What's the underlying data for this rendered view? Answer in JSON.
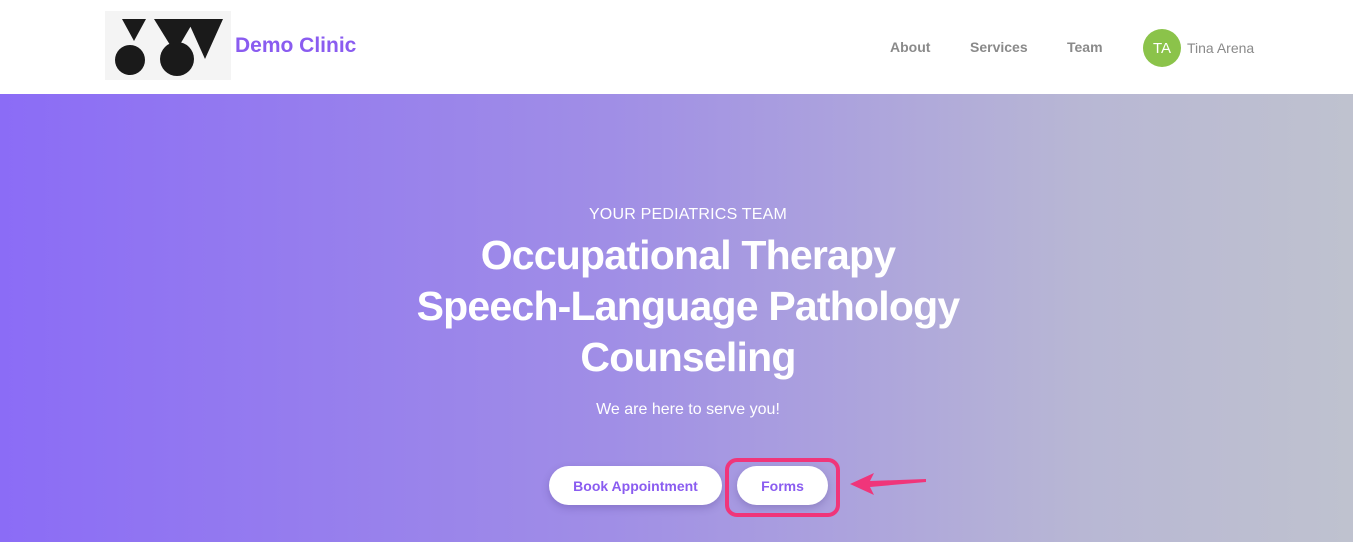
{
  "header": {
    "brand_name": "Demo Clinic",
    "logo_icon": "clinic-logo-icon",
    "nav": [
      {
        "label": "About"
      },
      {
        "label": "Services"
      },
      {
        "label": "Team"
      }
    ],
    "user": {
      "initials": "TA",
      "name": "Tina Arena",
      "avatar_color": "#8bc34a"
    }
  },
  "hero": {
    "kicker": "YOUR PEDIATRICS TEAM",
    "title_lines": [
      "Occupational Therapy",
      "Speech-Language Pathology",
      "Counseling"
    ],
    "subtitle": "We are here to serve you!",
    "buttons": {
      "book": "Book Appointment",
      "forms": "Forms"
    },
    "gradient_colors": [
      "#8b6cf6",
      "#bfc2cf"
    ]
  },
  "annotation": {
    "highlight_color": "#f0357a",
    "arrow_icon": "left-arrow-icon"
  },
  "colors": {
    "accent": "#8a5cf0",
    "nav_text": "#8a8a8a"
  }
}
